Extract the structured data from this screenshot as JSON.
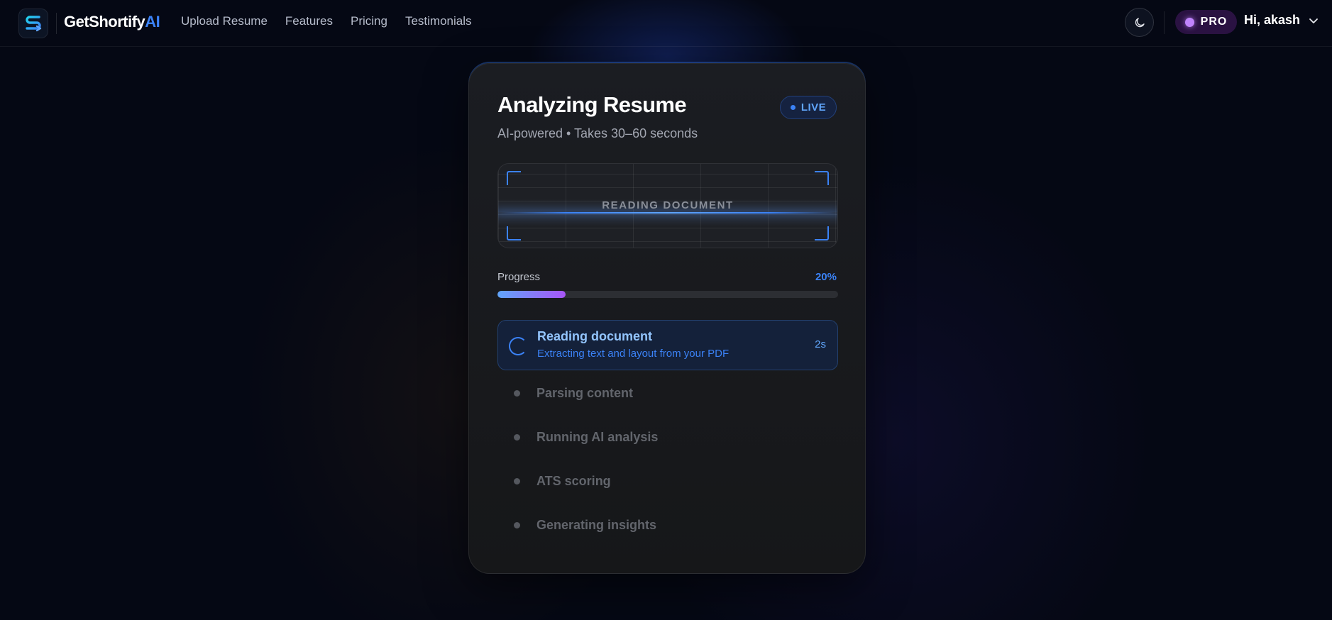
{
  "header": {
    "brand_name": "GetShortify",
    "brand_accent": "AI",
    "nav_links": [
      "Upload Resume",
      "Features",
      "Pricing",
      "Testimonials"
    ],
    "theme_toggle_icon": "moon-icon",
    "plan_badge": "PRO",
    "greeting": "Hi, akash",
    "user_menu_icon": "chevron-down-icon"
  },
  "card": {
    "title": "Analyzing Resume",
    "subtitle": "AI-powered • Takes 30–60 seconds",
    "live_badge": "LIVE",
    "scanner_label": "READING DOCUMENT",
    "progress": {
      "label": "Progress",
      "percent_text": "20%",
      "value": 0.2
    },
    "active_step": {
      "title": "Reading document",
      "description": "Extracting text and layout from your PDF",
      "elapsed": "2s"
    },
    "pending_steps": [
      "Parsing content",
      "Running AI analysis",
      "ATS scoring",
      "Generating insights"
    ]
  },
  "colors": {
    "accent_blue": "#3b82f6",
    "accent_purple": "#a855f7",
    "pro_purple": "#c084fc",
    "background": "#050814",
    "card": "#1b1d22"
  }
}
